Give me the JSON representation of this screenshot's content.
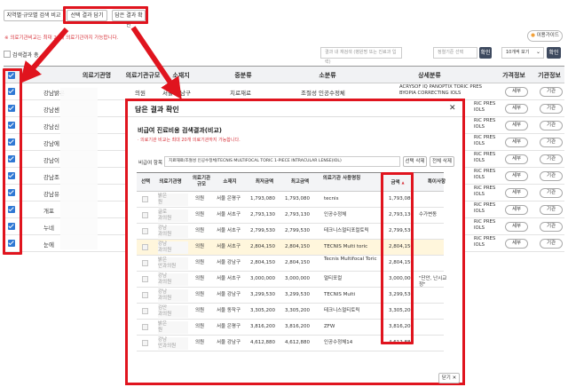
{
  "tabs": [
    {
      "label": "지역별·규모별 검색 비교"
    },
    {
      "label": "선택 결과 담기"
    },
    {
      "label": "담은 결과 확인"
    }
  ],
  "notice": "※ 의료기관비교는 최대 20개 의료기관까지 가능합니다.",
  "right_button": "이용가이드",
  "result_check_label": "검색결과 총",
  "search": {
    "placeholder": "결과 내 재검색 (병원명 또는 진료과 입력)",
    "sort_placeholder": "정렬기준 선택",
    "confirm": "확인",
    "page_size": "10개씩 보기",
    "confirm2": "확인"
  },
  "table": {
    "headers": [
      "의료기관명",
      "의료기관규모",
      "소재지",
      "중분류",
      "소분류",
      "상세분류",
      "가격정보",
      "기관정보"
    ],
    "rows": [
      {
        "name": "강남밝은",
        "scale": "의원",
        "location": "서울 강남구",
        "mid": "치료재료",
        "sub": "조절성 인공수정체",
        "detail": "ACRYSOF IQ PANOPTIX TORIC PRES BYOPIA CORRECTING IOLS",
        "price": "세부",
        "info": "기관"
      },
      {
        "name": "강남센",
        "scale": "",
        "location": "",
        "mid": "",
        "sub": "",
        "detail": "RIC PRES IOLS",
        "price": "세부",
        "info": "기관"
      },
      {
        "name": "강남신",
        "scale": "",
        "location": "",
        "mid": "",
        "sub": "",
        "detail": "RIC PRES IOLS",
        "price": "세부",
        "info": "기관"
      },
      {
        "name": "강남에",
        "scale": "",
        "location": "",
        "mid": "",
        "sub": "",
        "detail": "RIC PRES IOLS",
        "price": "세부",
        "info": "기관"
      },
      {
        "name": "강남이",
        "scale": "",
        "location": "",
        "mid": "",
        "sub": "",
        "detail": "RIC PRES IOLS",
        "price": "세부",
        "info": "기관"
      },
      {
        "name": "강남조",
        "scale": "",
        "location": "",
        "mid": "",
        "sub": "",
        "detail": "RIC PRES IOLS",
        "price": "세부",
        "info": "기관"
      },
      {
        "name": "강남유",
        "scale": "",
        "location": "",
        "mid": "",
        "sub": "",
        "detail": "RIC PRES IOLS",
        "price": "세부",
        "info": "기관"
      },
      {
        "name": "개포",
        "scale": "",
        "location": "",
        "mid": "",
        "sub": "",
        "detail": "RIC PRES IOLS",
        "price": "세부",
        "info": "기관"
      },
      {
        "name": "누네",
        "scale": "",
        "location": "",
        "mid": "",
        "sub": "",
        "detail": "RIC PRES IOLS",
        "price": "세부",
        "info": "기관"
      },
      {
        "name": "눈에",
        "scale": "",
        "location": "",
        "mid": "",
        "sub": "",
        "detail": "RIC PRES IOLS",
        "price": "세부",
        "info": "기관"
      }
    ]
  },
  "modal": {
    "title": "담은 결과 확인",
    "subtitle": "비급여 진료비용 검색결과(비교)",
    "note": "· 의료기관 비교는 최대 20개 의료기관까지 가능합니다.",
    "item_label": "비급여 항목",
    "item_value": "치료재료/조절성 인공수정체/TECNIS MULTIFOCAL TORIC 1-PIECE INTRACULAR LENSE(IOL)",
    "btn_delete_sel": "선택 삭제",
    "btn_delete_all": "전체 삭제",
    "headers": [
      "선택",
      "의료기관명",
      "의료기관 규모",
      "소재지",
      "최저금액",
      "최고금액",
      "의료기관 사용명칭",
      "금액",
      "특이사항"
    ],
    "sort_mark": "▲",
    "rows": [
      {
        "name": "밝은",
        "name2": "원",
        "scale": "의원",
        "loc": "서울 은평구",
        "min": "1,793,080",
        "max": "1,793,080",
        "use": "tecnis",
        "price": "1,793,080",
        "note": ""
      },
      {
        "name": "글로",
        "name2": "과의원",
        "scale": "의원",
        "loc": "서울 서초구",
        "min": "2,793,130",
        "max": "2,793,130",
        "use": "인공수정체",
        "price": "2,793,130",
        "note": "수가변동"
      },
      {
        "name": "강남",
        "name2": "과의원",
        "scale": "의원",
        "loc": "서울 서초구",
        "min": "2,799,530",
        "max": "2,799,530",
        "use": "테크니스멀티포컬토릭",
        "price": "2,799,530",
        "note": ""
      },
      {
        "name": "강남",
        "name2": "과의원",
        "scale": "의원",
        "loc": "서울 서초구",
        "min": "2,804,150",
        "max": "2,804,150",
        "use": "TECNIS Multi toric",
        "price": "2,804,150",
        "note": ""
      },
      {
        "name": "밝은",
        "name2": "안과의원",
        "scale": "의원",
        "loc": "서울 강남구",
        "min": "2,804,150",
        "max": "2,804,150",
        "use": "Tecnis Multifocal Toric",
        "price": "2,804,150",
        "note": ""
      },
      {
        "name": "강남",
        "name2": "과의원",
        "scale": "의원",
        "loc": "서울 서초구",
        "min": "3,000,000",
        "max": "3,000,000",
        "use": "멀티포컬",
        "price": "3,000,000",
        "note": "\"단안, 난시교정\""
      },
      {
        "name": "강남",
        "name2": "과의원",
        "scale": "의원",
        "loc": "서울 강남구",
        "min": "3,299,530",
        "max": "3,299,530",
        "use": "TECNIS Multi",
        "price": "3,299,530",
        "note": ""
      },
      {
        "name": "김안",
        "name2": "과의원",
        "scale": "의원",
        "loc": "서울 동작구",
        "min": "3,305,200",
        "max": "3,305,200",
        "use": "테크니스멀티토릭",
        "price": "3,305,200",
        "note": ""
      },
      {
        "name": "밝은",
        "name2": "원",
        "scale": "의원",
        "loc": "서울 은평구",
        "min": "3,816,200",
        "max": "3,816,200",
        "use": "ZFW",
        "price": "3,816,200",
        "note": ""
      },
      {
        "name": "강남",
        "name2": "안과의원",
        "scale": "의원",
        "loc": "서울 강남구",
        "min": "4,612,880",
        "max": "4,612,880",
        "use": "인공수정체14",
        "price": "4,612,880",
        "note": ""
      }
    ],
    "close_label": "닫기"
  }
}
